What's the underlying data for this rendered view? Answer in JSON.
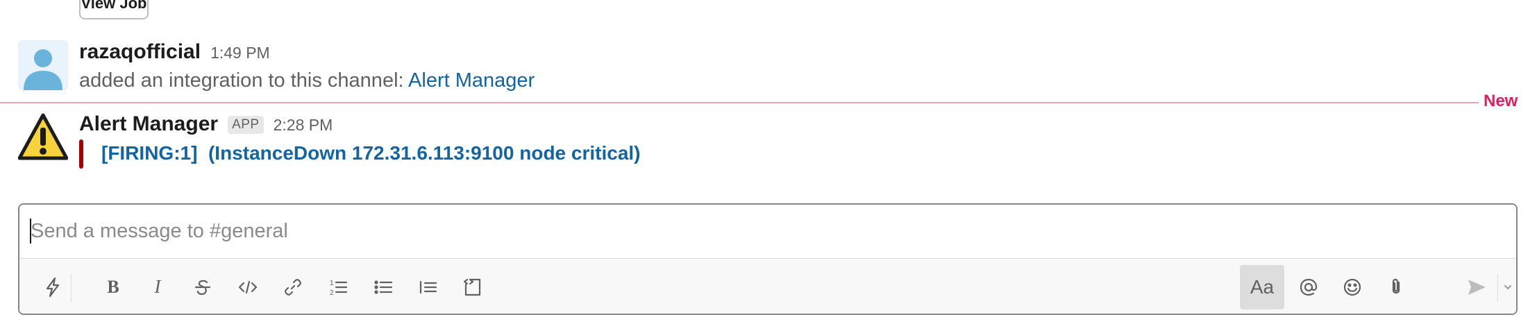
{
  "top_button": {
    "label": "View Job"
  },
  "message_user": {
    "username": "razaqofficial",
    "time": "1:49 PM",
    "text": "added an integration to this channel: ",
    "link": "Alert Manager"
  },
  "divider": {
    "label": "New"
  },
  "message_app": {
    "username": "Alert Manager",
    "badge": "APP",
    "time": "2:28 PM",
    "attachment_title": "[FIRING:1]  (InstanceDown 172.31.6.113:9100 node critical)",
    "attachment_color": "#a30200"
  },
  "composer": {
    "placeholder": "Send a message to #general",
    "value": "",
    "toolbar": {
      "shortcuts": "lightning-icon",
      "bold": "bold-icon",
      "italic": "italic-icon",
      "strike": "strikethrough-icon",
      "code": "code-icon",
      "link": "link-icon",
      "ordered_list": "ordered-list-icon",
      "bullet_list": "bullet-list-icon",
      "blockquote": "blockquote-icon",
      "code_block": "code-block-icon",
      "format_toggle": "Aa",
      "mention": "at-icon",
      "emoji": "emoji-icon",
      "attach": "paperclip-icon",
      "send": "send-icon",
      "send_options": "chevron-down-icon"
    }
  },
  "colors": {
    "link": "#1264a3",
    "new_divider": "#e01e5a",
    "attachment_bar": "#a30200"
  }
}
